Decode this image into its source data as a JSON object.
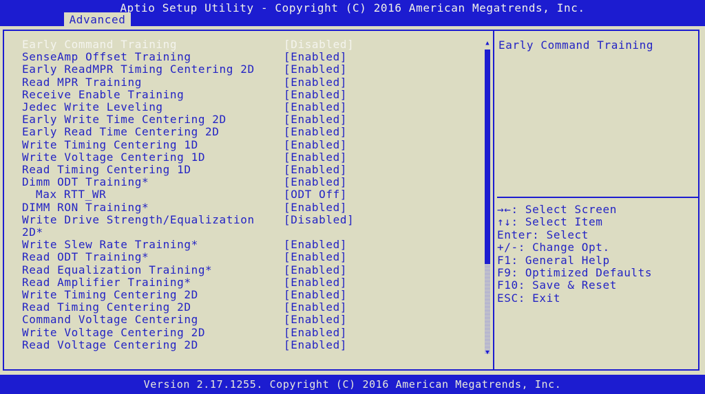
{
  "header": {
    "title": "Aptio Setup Utility - Copyright (C) 2016 American Megatrends, Inc.",
    "tab": "Advanced"
  },
  "items": [
    {
      "label": "Early Command Training",
      "value": "[Disabled]",
      "selected": true
    },
    {
      "label": "SenseAmp Offset Training",
      "value": "[Enabled]"
    },
    {
      "label": "Early ReadMPR Timing Centering 2D",
      "value": "[Enabled]"
    },
    {
      "label": "Read MPR Training",
      "value": "[Enabled]"
    },
    {
      "label": "Receive Enable Training",
      "value": "[Enabled]"
    },
    {
      "label": "Jedec Write Leveling",
      "value": "[Enabled]"
    },
    {
      "label": "Early Write Time Centering 2D",
      "value": "[Enabled]"
    },
    {
      "label": "Early Read Time Centering 2D",
      "value": "[Enabled]"
    },
    {
      "label": "Write Timing Centering 1D",
      "value": "[Enabled]"
    },
    {
      "label": "Write Voltage Centering 1D",
      "value": "[Enabled]"
    },
    {
      "label": "Read Timing Centering 1D",
      "value": "[Enabled]"
    },
    {
      "label": "Dimm ODT Training*",
      "value": "[Enabled]"
    },
    {
      "label": "Max RTT_WR",
      "value": "[ODT Off]",
      "indent": true
    },
    {
      "label": "DIMM RON Training*",
      "value": "[Enabled]"
    },
    {
      "label": "Write Drive Strength/Equalization 2D*",
      "value": "[Disabled]"
    },
    {
      "label": "Write Slew Rate Training*",
      "value": "[Enabled]"
    },
    {
      "label": "Read ODT Training*",
      "value": "[Enabled]"
    },
    {
      "label": "Read Equalization Training*",
      "value": "[Enabled]"
    },
    {
      "label": "Read Amplifier Training*",
      "value": "[Enabled]"
    },
    {
      "label": "Write Timing Centering 2D",
      "value": "[Enabled]"
    },
    {
      "label": "Read Timing Centering 2D",
      "value": "[Enabled]"
    },
    {
      "label": "Command Voltage Centering",
      "value": "[Enabled]"
    },
    {
      "label": "Write Voltage Centering 2D",
      "value": "[Enabled]"
    },
    {
      "label": "Read Voltage Centering 2D",
      "value": "[Enabled]"
    }
  ],
  "scrollbar": {
    "up_icon": "▲",
    "down_icon": "▼"
  },
  "help": {
    "text": "Early Command Training"
  },
  "keys": [
    "→←: Select Screen",
    "↑↓: Select Item",
    "Enter: Select",
    "+/-: Change Opt.",
    "F1: General Help",
    "F9: Optimized Defaults",
    "F10: Save & Reset",
    "ESC: Exit"
  ],
  "footer": {
    "text": "Version 2.17.1255. Copyright (C) 2016 American Megatrends, Inc."
  },
  "colors": {
    "blue": "#1c1cd0",
    "panel": "#dcdcc2",
    "text": "#2323c4",
    "selected_text": "#f4f4ee"
  }
}
